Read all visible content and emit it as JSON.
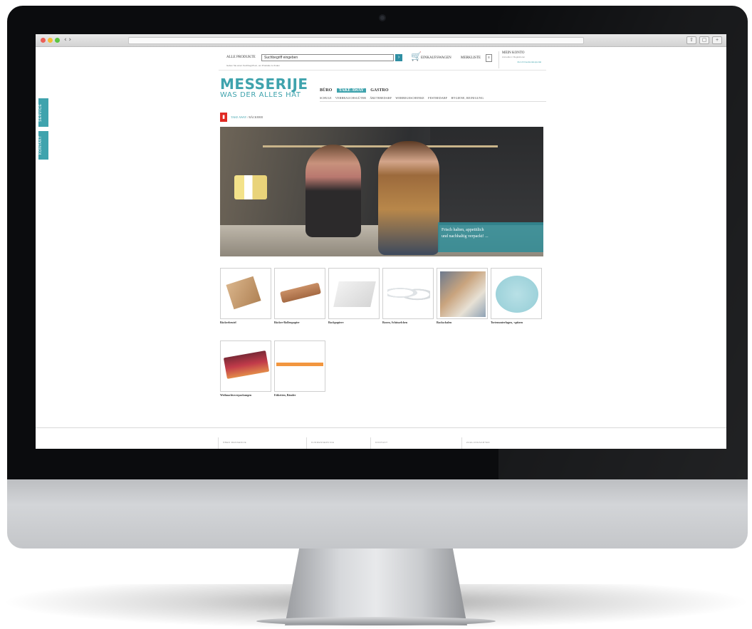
{
  "window": {
    "nav_arrows": "‹ ›"
  },
  "side_tabs": [
    "SERVICE",
    "KONTAKT"
  ],
  "header": {
    "all_products_label": "ALLE PRODUKTE",
    "search_value": "Suchbegriff eingeben",
    "search_hint": "Geben Sie einen Suchbegriff ein, um Produkte zu finden",
    "cart_label": "EINKAUFSWAGEN",
    "merkliste_label": "MERKLISTE",
    "account_title": "MEIN KONTO",
    "account_sub": "Anmelden / Registrieren",
    "account_link": "Zum Firmenkundenportal"
  },
  "logo": {
    "main": "MESSERIJE",
    "sub": "WAS DER ALLES HAT"
  },
  "categories_main": [
    {
      "label": "BÜRO",
      "active": false
    },
    {
      "label": "TAKE AWAY",
      "active": true
    },
    {
      "label": "GASTRO",
      "active": false
    }
  ],
  "categories_sub": [
    "SCHULE",
    "VERBRAUCHSGÜTER",
    "ÄRZTEBEDARF",
    "WERBEGESCHENKE",
    "FESTBEDARF",
    "HYGIENE, REINIGUNG"
  ],
  "breadcrumb": {
    "link": "TAKE AWAY",
    "separator": "/",
    "current": "BÄCKEREI"
  },
  "hero": {
    "caption_line1": "Frisch halten, appetitlich",
    "caption_line2": "und nachhaltig verpackt! ..."
  },
  "products": [
    {
      "label": "Bäckerbeutel",
      "image": "paper-bags"
    },
    {
      "label": "Bäcker-Rollenpapier",
      "image": "paper-roll"
    },
    {
      "label": "Backpapiere",
      "image": "baking-paper"
    },
    {
      "label": "Boxen, Schüsselchen",
      "image": "bowls"
    },
    {
      "label": "Backschalen",
      "image": "photo"
    },
    {
      "label": "Tortenunterlagen, -spitzen",
      "image": "cake-board"
    },
    {
      "label": "Weihnachtsverpackungen",
      "image": "gift-boxes"
    },
    {
      "label": "Etiketten, Bänder",
      "image": "labels"
    }
  ],
  "footer_columns": [
    "ÜBER MESSERIJE",
    "KUNDENSERVICE",
    "KONTAKT",
    "ZAHLUNGSARTEN"
  ],
  "colors": {
    "accent": "#3fa3ad",
    "crumb_icon": "#e02a24"
  }
}
